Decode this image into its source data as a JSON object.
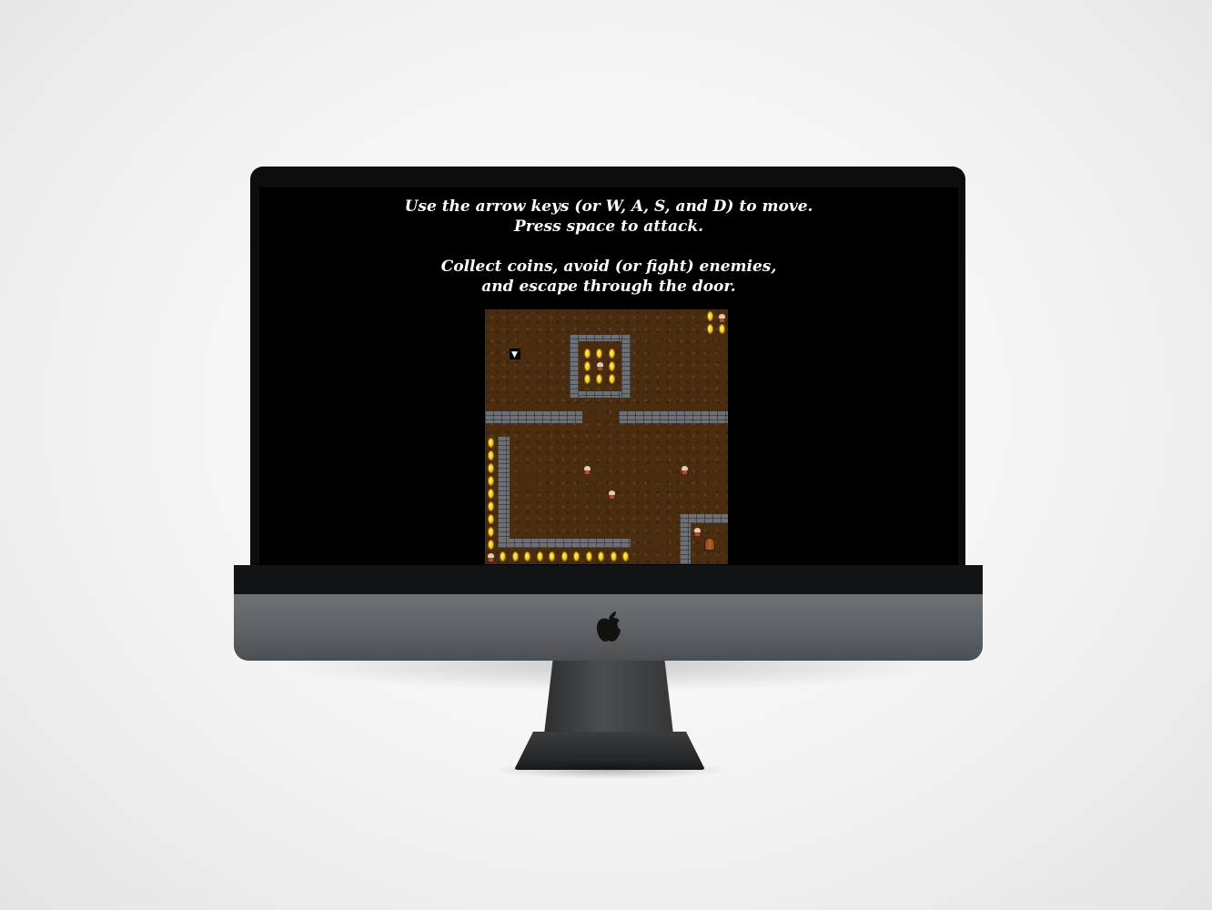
{
  "instructions": {
    "line1": "Use the arrow keys (or W, A, S, and D) to move.",
    "line2": "Press space to attack.",
    "line3": "Collect coins, avoid (or fight) enemies,",
    "line4": "and escape through the door."
  },
  "game": {
    "player_icon": "triangle-down-icon",
    "colors": {
      "floor": "#4a2d10",
      "wall": "#6d7077",
      "coin": "#f4c518",
      "door": "#b8642a",
      "screen": "#000000"
    }
  }
}
